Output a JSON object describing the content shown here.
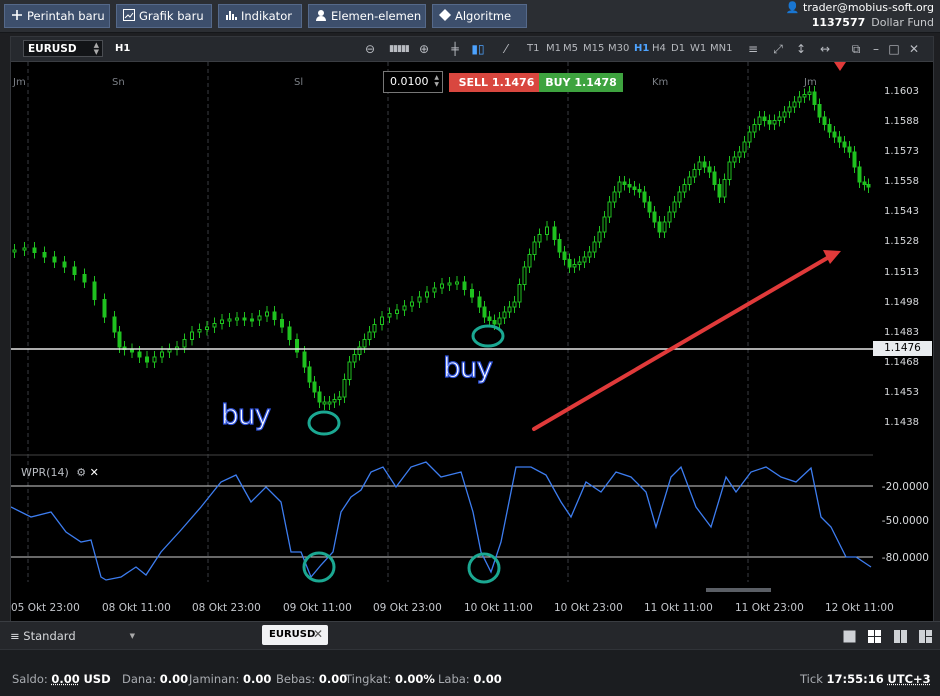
{
  "menu": {
    "new_order": "Perintah baru",
    "new_chart": "Grafik baru",
    "indicator": "Indikator",
    "elements": "Elemen-elemen",
    "algorithm": "Algoritme"
  },
  "account": {
    "user": "trader@mobius-soft.org",
    "number": "1137577",
    "fund": "Dollar Fund"
  },
  "chart": {
    "symbol": "EURUSD",
    "timeframe": "H1",
    "timeframes": [
      "T1",
      "M1",
      "M5",
      "M15",
      "M30",
      "H1",
      "H4",
      "D1",
      "W1",
      "MN1"
    ],
    "active_timeframe": "H1",
    "day_labels": [
      "Jm",
      "Sn",
      "Sl",
      "Km",
      "Jm"
    ],
    "order": {
      "quantity": "0.0100",
      "sell_label": "SELL",
      "sell_price": "1.1476",
      "buy_label": "BUY",
      "buy_price": "1.1478"
    },
    "price_ticks": [
      "1.1603",
      "1.1588",
      "1.1573",
      "1.1558",
      "1.1543",
      "1.1528",
      "1.1513",
      "1.1498",
      "1.1483",
      "1.1468",
      "1.1453",
      "1.1438"
    ],
    "current_price": "1.1476",
    "annotations": [
      "buy",
      "buy"
    ]
  },
  "indicator": {
    "title": "WPR(14)",
    "levels": [
      "-20.0000",
      "-50.0000",
      "-80.0000"
    ]
  },
  "time_axis": [
    "05 Okt 23:00",
    "08 Okt 11:00",
    "08 Okt 23:00",
    "09 Okt 11:00",
    "09 Okt 23:00",
    "10 Okt 11:00",
    "10 Okt 23:00",
    "11 Okt 11:00",
    "11 Okt 23:00",
    "12 Okt 11:00"
  ],
  "tabs": {
    "layout": "Standard",
    "open_tab": "EURUSD"
  },
  "status": {
    "saldo_label": "Saldo:",
    "saldo_value": "0.00",
    "saldo_currency": "USD",
    "dana_label": "Dana:",
    "dana_value": "0.00",
    "jaminan_label": "Jaminan:",
    "jaminan_value": "0.00",
    "bebas_label": "Bebas:",
    "bebas_value": "0.00",
    "tingkat_label": "Tingkat:",
    "tingkat_value": "0.00%",
    "laba_label": "Laba:",
    "laba_value": "0.00",
    "tick_label": "Tick",
    "time": "17:55:16",
    "timezone": "UTC+3"
  },
  "colors": {
    "bull": "#1fc11f",
    "bear": "#1fc11f",
    "wpr_line": "#3d7df0",
    "arrow": "#e03a3a",
    "circle": "#1ba892"
  }
}
